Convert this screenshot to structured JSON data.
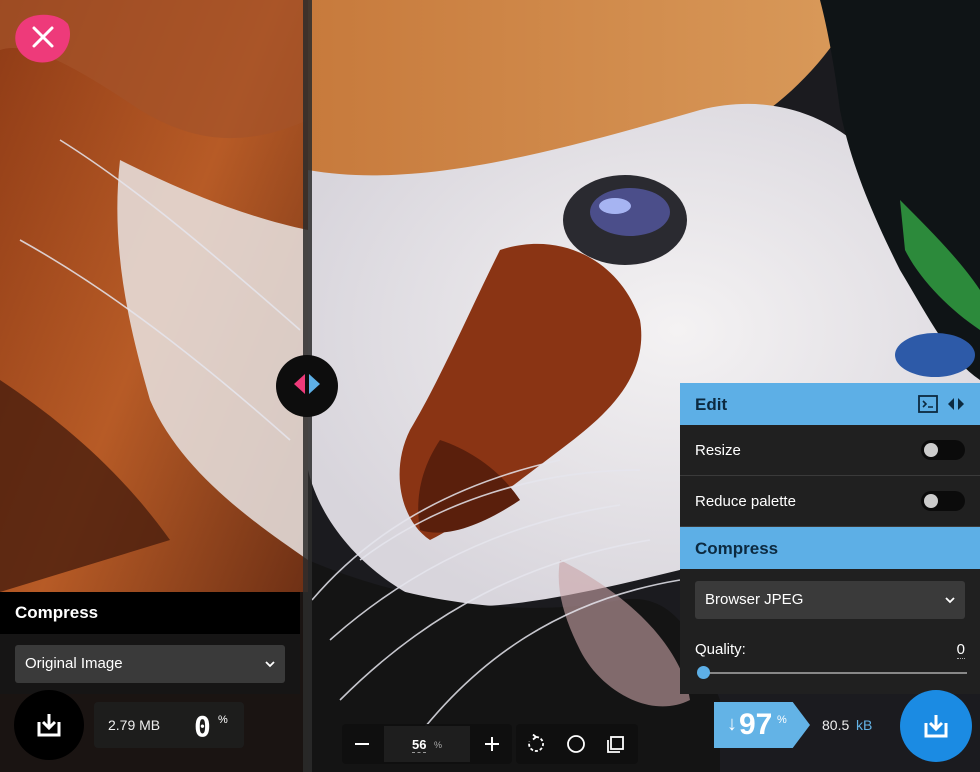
{
  "left_panel": {
    "heading": "Compress",
    "method": "Original Image",
    "size": "2.79 MB",
    "percent": "0",
    "percent_sign": "%"
  },
  "right_panel": {
    "edit_heading": "Edit",
    "resize_label": "Resize",
    "resize_on": false,
    "reduce_palette_label": "Reduce palette",
    "reduce_palette_on": false,
    "compress_heading": "Compress",
    "method": "Browser JPEG",
    "quality_label": "Quality:",
    "quality_value": "0",
    "quality_fraction": 0.0
  },
  "right_stats": {
    "arrow": "↓",
    "percent": "97",
    "percent_sign": "%",
    "size_value": "80.5",
    "size_unit": "kB"
  },
  "toolbar": {
    "zoom_value": "56",
    "zoom_unit": "%"
  },
  "icons": {
    "close": "close-icon",
    "split_handle": "split-arrows-icon",
    "download": "download-icon",
    "terminal": "terminal-icon",
    "swap_sides": "swap-sides-icon",
    "chevron": "chevron-down-icon",
    "zoom_out": "minus-icon",
    "zoom_in": "plus-icon",
    "rotate": "rotate-icon",
    "background": "circle-icon",
    "crop": "crop-icon"
  },
  "colors": {
    "accent_blue": "#5dafe6",
    "accent_pink": "#ee3a7a",
    "download_blue": "#1b8be3",
    "fur_orange": "#b65a1e",
    "fur_dark": "#6a2a12"
  }
}
